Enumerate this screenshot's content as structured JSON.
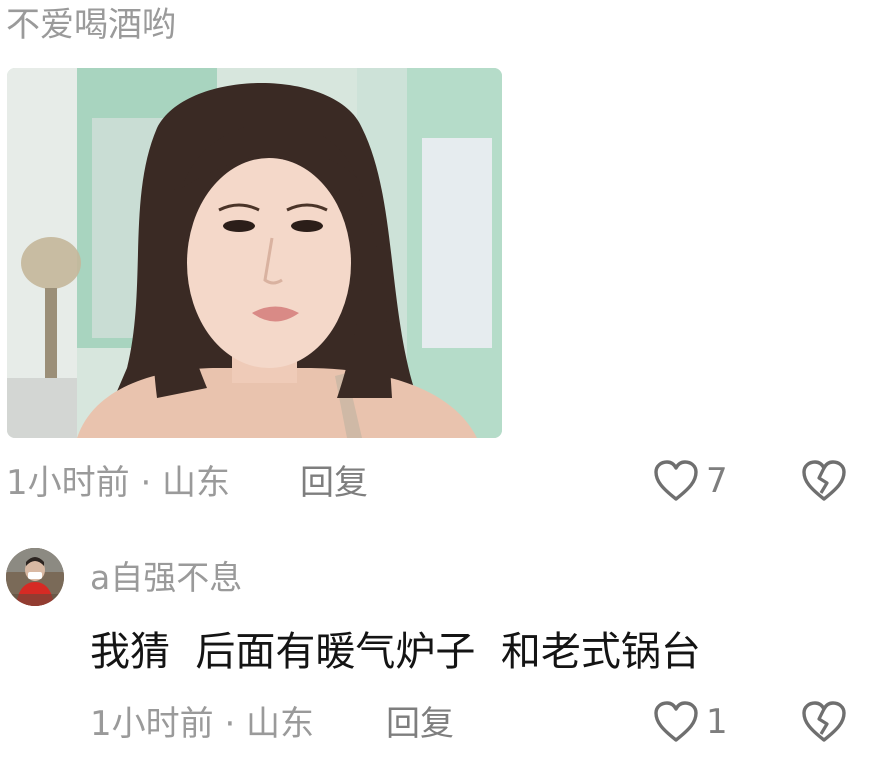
{
  "comment1": {
    "text": "不爱喝酒哟",
    "image_alt": "selfie photo of a woman with long dark hair",
    "time_location": "1小时前 · 山东",
    "reply_label": "回复",
    "like_count": "7"
  },
  "comment2": {
    "username": "a自强不息",
    "text": "我猜  后面有暖气炉子  和老式锅台",
    "time_location": "1小时前 · 山东",
    "reply_label": "回复",
    "like_count": "1"
  },
  "icons": {
    "like": "heart-outline-icon",
    "dislike": "broken-heart-icon"
  },
  "colors": {
    "meta_gray": "#9a9a9a",
    "text_dark": "#141414",
    "icon_gray": "#6f6f6f"
  }
}
